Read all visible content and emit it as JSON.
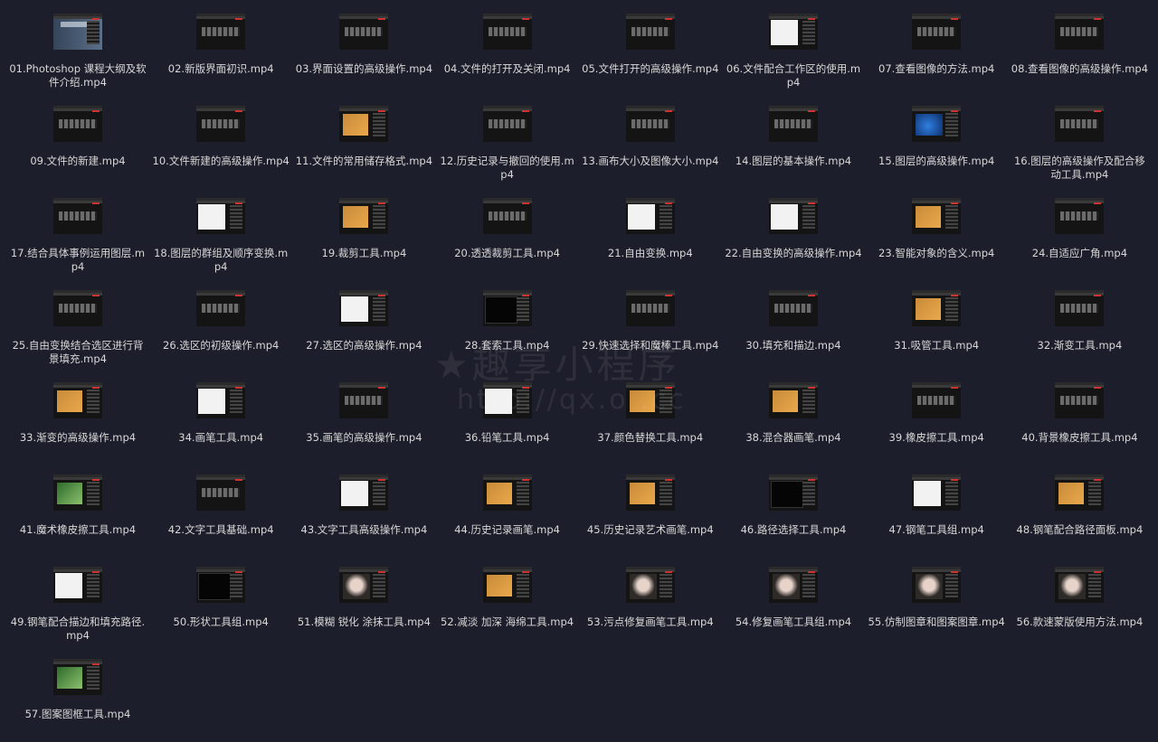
{
  "files": [
    {
      "name": "01.Photoshop 课程大纲及软件介绍.mp4",
      "thumb": "cover"
    },
    {
      "name": "02.新版界面初识.mp4",
      "thumb": "ui"
    },
    {
      "name": "03.界面设置的高级操作.mp4",
      "thumb": "ui"
    },
    {
      "name": "04.文件的打开及关闭.mp4",
      "thumb": "ui"
    },
    {
      "name": "05.文件打开的高级操作.mp4",
      "thumb": "ui"
    },
    {
      "name": "06.文件配合工作区的使用.mp4",
      "thumb": "light"
    },
    {
      "name": "07.查看图像的方法.mp4",
      "thumb": "ui"
    },
    {
      "name": "08.查看图像的高级操作.mp4",
      "thumb": "ui"
    },
    {
      "name": "09.文件的新建.mp4",
      "thumb": "ui"
    },
    {
      "name": "10.文件新建的高级操作.mp4",
      "thumb": "ui"
    },
    {
      "name": "11.文件的常用储存格式.mp4",
      "thumb": "photo"
    },
    {
      "name": "12.历史记录与撤回的使用.mp4",
      "thumb": "ui"
    },
    {
      "name": "13.画布大小及图像大小.mp4",
      "thumb": "ui"
    },
    {
      "name": "14.图层的基本操作.mp4",
      "thumb": "ui"
    },
    {
      "name": "15.图层的高级操作.mp4",
      "thumb": "blue"
    },
    {
      "name": "16.图层的高级操作及配合移动工具.mp4",
      "thumb": "ui"
    },
    {
      "name": "17.结合具体事例运用图层.mp4",
      "thumb": "ui"
    },
    {
      "name": "18.图层的群组及顺序变换.mp4",
      "thumb": "light"
    },
    {
      "name": "19.裁剪工具.mp4",
      "thumb": "photo"
    },
    {
      "name": "20.透透裁剪工具.mp4",
      "thumb": "ui"
    },
    {
      "name": "21.自由变换.mp4",
      "thumb": "light"
    },
    {
      "name": "22.自由变换的高级操作.mp4",
      "thumb": "light"
    },
    {
      "name": "23.智能对象的含义.mp4",
      "thumb": "photo"
    },
    {
      "name": "24.自适应广角.mp4",
      "thumb": "ui"
    },
    {
      "name": "25.自由变换结合选区进行背景填充.mp4",
      "thumb": "ui"
    },
    {
      "name": "26.选区的初级操作.mp4",
      "thumb": "ui"
    },
    {
      "name": "27.选区的高级操作.mp4",
      "thumb": "light"
    },
    {
      "name": "28.套索工具.mp4",
      "thumb": "dark"
    },
    {
      "name": "29.快速选择和魔棒工具.mp4",
      "thumb": "ui"
    },
    {
      "name": "30.填充和描边.mp4",
      "thumb": "ui"
    },
    {
      "name": "31.吸管工具.mp4",
      "thumb": "photo"
    },
    {
      "name": "32.渐变工具.mp4",
      "thumb": "ui"
    },
    {
      "name": "33.渐变的高级操作.mp4",
      "thumb": "photo"
    },
    {
      "name": "34.画笔工具.mp4",
      "thumb": "light"
    },
    {
      "name": "35.画笔的高级操作.mp4",
      "thumb": "ui"
    },
    {
      "name": "36.铅笔工具.mp4",
      "thumb": "light"
    },
    {
      "name": "37.颜色替换工具.mp4",
      "thumb": "photo"
    },
    {
      "name": "38.混合器画笔.mp4",
      "thumb": "photo"
    },
    {
      "name": "39.橡皮擦工具.mp4",
      "thumb": "ui"
    },
    {
      "name": "40.背景橡皮擦工具.mp4",
      "thumb": "ui"
    },
    {
      "name": "41.魔术橡皮擦工具.mp4",
      "thumb": "green"
    },
    {
      "name": "42.文字工具基础.mp4",
      "thumb": "ui"
    },
    {
      "name": "43.文字工具高级操作.mp4",
      "thumb": "light"
    },
    {
      "name": "44.历史记录画笔.mp4",
      "thumb": "photo"
    },
    {
      "name": "45.历史记录艺术画笔.mp4",
      "thumb": "photo"
    },
    {
      "name": "46.路径选择工具.mp4",
      "thumb": "dark"
    },
    {
      "name": "47.钢笔工具组.mp4",
      "thumb": "light"
    },
    {
      "name": "48.钢笔配合路径面板.mp4",
      "thumb": "photo"
    },
    {
      "name": "49.钢笔配合描边和填充路径.mp4",
      "thumb": "light"
    },
    {
      "name": "50.形状工具组.mp4",
      "thumb": "dark"
    },
    {
      "name": "51.模糊 锐化 涂抹工具.mp4",
      "thumb": "face"
    },
    {
      "name": "52.减淡 加深 海绵工具.mp4",
      "thumb": "photo"
    },
    {
      "name": "53.污点修复画笔工具.mp4",
      "thumb": "face"
    },
    {
      "name": "54.修复画笔工具组.mp4",
      "thumb": "face"
    },
    {
      "name": "55.仿制图章和图案图章.mp4",
      "thumb": "face"
    },
    {
      "name": "56.款速蒙版使用方法.mp4",
      "thumb": "face"
    },
    {
      "name": "57.图案图框工具.mp4",
      "thumb": "green"
    }
  ],
  "watermark": {
    "line1": "★趣享小程序",
    "line2": "http://qx.o   .cc"
  }
}
